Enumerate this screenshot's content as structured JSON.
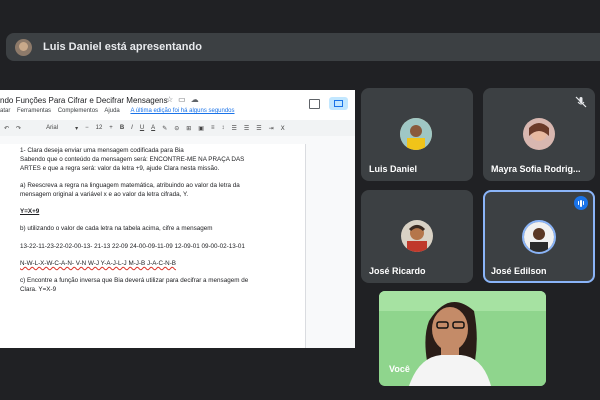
{
  "presenter_banner": {
    "text": "Luis Daniel está apresentando"
  },
  "doc": {
    "title": "ndo Funções Para Cifrar e Decifrar Mensagens",
    "menu": [
      "atar",
      "Ferramentas",
      "Complementos",
      "Ajuda"
    ],
    "last_edit": "A última edição foi há alguns segundos",
    "toolbar": {
      "font": "Arial",
      "size": "12"
    },
    "lines": [
      "1- Clara deseja enviar uma mensagem codificada para Bia",
      "Sabendo que o conteúdo da mensagem será: ENCONTRE-ME NA PRAÇA DAS",
      "ARTES e que a regra será: valor da letra +9, ajude Clara nesta missão.",
      "a) Reescreva a regra na linguagem matemática, atribuindo ao valor da letra da",
      "mensagem original a variável x e ao valor da letra cifrada, Y.",
      "Y=X+9",
      "b) utilizando o valor de cada letra na tabela acima, cifre a mensagem",
      "13-22-11-23-22-02-00-13-  21-13  22-09  24-00-09-11-09  12-09-01  09-00-02-13-01",
      "N-W-L-X-W-C-A-N-  V-N  W-J  Y-A-J-L-J  M-J-B  J-A-C-N-B",
      "c) Encontre a função inversa que Bia deverá utilizar para decifrar a mensagem de",
      "Clara. Y=X-9"
    ]
  },
  "participants": [
    {
      "name": "Luis Daniel"
    },
    {
      "name": "Mayra Sofia Rodrig..."
    },
    {
      "name": "José Ricardo"
    },
    {
      "name": "José Edilson"
    }
  ],
  "self": {
    "name": "Você"
  },
  "colors": {
    "background": "#202124",
    "tile": "#3c4043",
    "accent": "#8ab4f8",
    "speaking": "#1a73e8"
  }
}
